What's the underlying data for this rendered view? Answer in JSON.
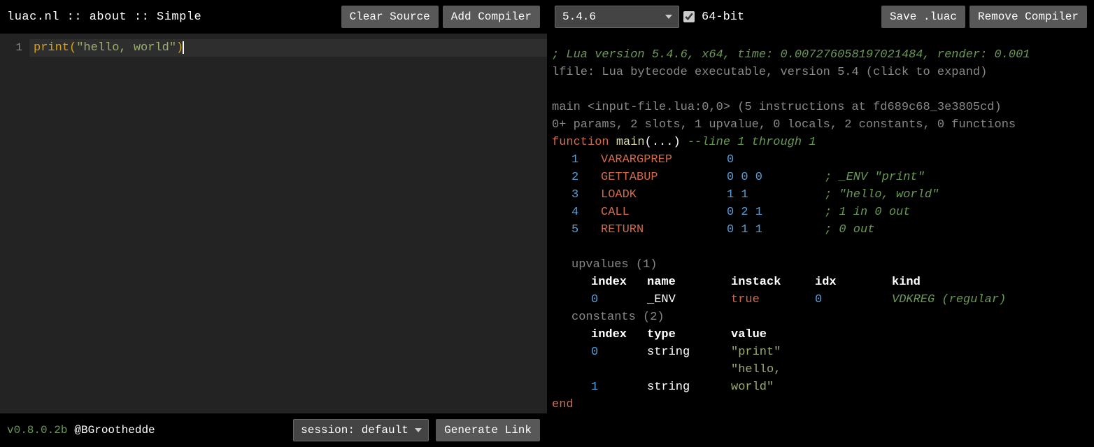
{
  "colors": {
    "comment": "#6a9955",
    "keyword": "#d16949",
    "name": "#dcdcaa",
    "num": "#569cd6",
    "string": "#9aad6c"
  },
  "left": {
    "breadcrumb": "luac.nl :: about :: Simple",
    "clear_btn": "Clear Source",
    "add_btn": "Add Compiler",
    "gutter_1": "1",
    "code_fn": "print",
    "code_paren_l": "(",
    "code_str": "\"hello, world\"",
    "code_paren_r": ")",
    "version": "v0.8.0.2b",
    "handle": "@BGroothedde",
    "session_select": "session: default",
    "gen_link_btn": "Generate Link"
  },
  "right": {
    "version_select": "5.4.6",
    "bits_label": "64-bit",
    "save_btn": "Save .luac",
    "remove_btn": "Remove Compiler",
    "info_line": "; Lua version 5.4.6, x64, time: 0.007276058197021484, render: 0.001",
    "lfile": "lfile: Lua bytecode executable, version 5.4 (click to expand)",
    "main_hdr": "main <input-file.lua:0,0> (5 instructions at fd689c68_3e3805cd)",
    "params": "0+ params, 2 slots, 1 upvalue, 0 locals, 2 constants, 0 functions",
    "fn_kw": "function",
    "fn_name": "main",
    "fn_args": "(...)",
    "fn_cmt": "--line 1 through 1",
    "instructions": [
      {
        "n": "1",
        "op": "VARARGPREP",
        "args": "0",
        "cmt": ""
      },
      {
        "n": "2",
        "op": "GETTABUP",
        "args": "0 0 0",
        "cmt": "; _ENV \"print\""
      },
      {
        "n": "3",
        "op": "LOADK",
        "args": "1 1",
        "cmt": "; \"hello, world\""
      },
      {
        "n": "4",
        "op": "CALL",
        "args": "0 2 1",
        "cmt": "; 1 in 0 out"
      },
      {
        "n": "5",
        "op": "RETURN",
        "args": "0 1 1",
        "cmt": "; 0 out"
      }
    ],
    "upvalues_hdr": "upvalues (1)",
    "upv_cols": {
      "a": "index",
      "b": "name",
      "c": "instack",
      "d": "idx",
      "e": "kind"
    },
    "upvalues": [
      {
        "index": "0",
        "name": "_ENV",
        "instack": "true",
        "idx": "0",
        "kind": "VDKREG (regular)"
      }
    ],
    "constants_hdr": "constants (2)",
    "const_cols": {
      "a": "index",
      "b": "type",
      "c": "value"
    },
    "constants": [
      {
        "index": "0",
        "type": "string",
        "value": "\"print\""
      },
      {
        "index": "1",
        "type": "string",
        "value": "\"hello, world\""
      }
    ],
    "end_kw": "end"
  }
}
